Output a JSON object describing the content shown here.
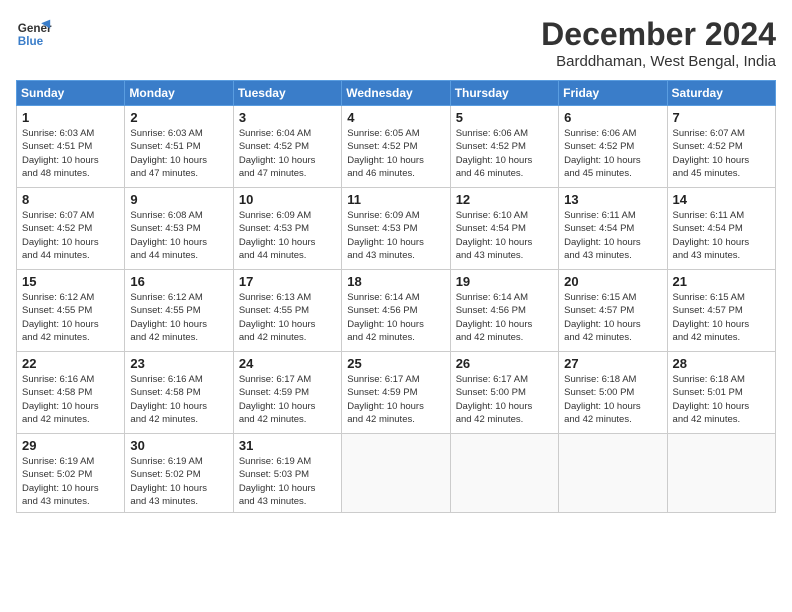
{
  "header": {
    "logo_line1": "General",
    "logo_line2": "Blue",
    "month": "December 2024",
    "location": "Barddhaman, West Bengal, India"
  },
  "weekdays": [
    "Sunday",
    "Monday",
    "Tuesday",
    "Wednesday",
    "Thursday",
    "Friday",
    "Saturday"
  ],
  "weeks": [
    [
      {
        "day": 1,
        "info": "Sunrise: 6:03 AM\nSunset: 4:51 PM\nDaylight: 10 hours\nand 48 minutes."
      },
      {
        "day": 2,
        "info": "Sunrise: 6:03 AM\nSunset: 4:51 PM\nDaylight: 10 hours\nand 47 minutes."
      },
      {
        "day": 3,
        "info": "Sunrise: 6:04 AM\nSunset: 4:52 PM\nDaylight: 10 hours\nand 47 minutes."
      },
      {
        "day": 4,
        "info": "Sunrise: 6:05 AM\nSunset: 4:52 PM\nDaylight: 10 hours\nand 46 minutes."
      },
      {
        "day": 5,
        "info": "Sunrise: 6:06 AM\nSunset: 4:52 PM\nDaylight: 10 hours\nand 46 minutes."
      },
      {
        "day": 6,
        "info": "Sunrise: 6:06 AM\nSunset: 4:52 PM\nDaylight: 10 hours\nand 45 minutes."
      },
      {
        "day": 7,
        "info": "Sunrise: 6:07 AM\nSunset: 4:52 PM\nDaylight: 10 hours\nand 45 minutes."
      }
    ],
    [
      {
        "day": 8,
        "info": "Sunrise: 6:07 AM\nSunset: 4:52 PM\nDaylight: 10 hours\nand 44 minutes."
      },
      {
        "day": 9,
        "info": "Sunrise: 6:08 AM\nSunset: 4:53 PM\nDaylight: 10 hours\nand 44 minutes."
      },
      {
        "day": 10,
        "info": "Sunrise: 6:09 AM\nSunset: 4:53 PM\nDaylight: 10 hours\nand 44 minutes."
      },
      {
        "day": 11,
        "info": "Sunrise: 6:09 AM\nSunset: 4:53 PM\nDaylight: 10 hours\nand 43 minutes."
      },
      {
        "day": 12,
        "info": "Sunrise: 6:10 AM\nSunset: 4:54 PM\nDaylight: 10 hours\nand 43 minutes."
      },
      {
        "day": 13,
        "info": "Sunrise: 6:11 AM\nSunset: 4:54 PM\nDaylight: 10 hours\nand 43 minutes."
      },
      {
        "day": 14,
        "info": "Sunrise: 6:11 AM\nSunset: 4:54 PM\nDaylight: 10 hours\nand 43 minutes."
      }
    ],
    [
      {
        "day": 15,
        "info": "Sunrise: 6:12 AM\nSunset: 4:55 PM\nDaylight: 10 hours\nand 42 minutes."
      },
      {
        "day": 16,
        "info": "Sunrise: 6:12 AM\nSunset: 4:55 PM\nDaylight: 10 hours\nand 42 minutes."
      },
      {
        "day": 17,
        "info": "Sunrise: 6:13 AM\nSunset: 4:55 PM\nDaylight: 10 hours\nand 42 minutes."
      },
      {
        "day": 18,
        "info": "Sunrise: 6:14 AM\nSunset: 4:56 PM\nDaylight: 10 hours\nand 42 minutes."
      },
      {
        "day": 19,
        "info": "Sunrise: 6:14 AM\nSunset: 4:56 PM\nDaylight: 10 hours\nand 42 minutes."
      },
      {
        "day": 20,
        "info": "Sunrise: 6:15 AM\nSunset: 4:57 PM\nDaylight: 10 hours\nand 42 minutes."
      },
      {
        "day": 21,
        "info": "Sunrise: 6:15 AM\nSunset: 4:57 PM\nDaylight: 10 hours\nand 42 minutes."
      }
    ],
    [
      {
        "day": 22,
        "info": "Sunrise: 6:16 AM\nSunset: 4:58 PM\nDaylight: 10 hours\nand 42 minutes."
      },
      {
        "day": 23,
        "info": "Sunrise: 6:16 AM\nSunset: 4:58 PM\nDaylight: 10 hours\nand 42 minutes."
      },
      {
        "day": 24,
        "info": "Sunrise: 6:17 AM\nSunset: 4:59 PM\nDaylight: 10 hours\nand 42 minutes."
      },
      {
        "day": 25,
        "info": "Sunrise: 6:17 AM\nSunset: 4:59 PM\nDaylight: 10 hours\nand 42 minutes."
      },
      {
        "day": 26,
        "info": "Sunrise: 6:17 AM\nSunset: 5:00 PM\nDaylight: 10 hours\nand 42 minutes."
      },
      {
        "day": 27,
        "info": "Sunrise: 6:18 AM\nSunset: 5:00 PM\nDaylight: 10 hours\nand 42 minutes."
      },
      {
        "day": 28,
        "info": "Sunrise: 6:18 AM\nSunset: 5:01 PM\nDaylight: 10 hours\nand 42 minutes."
      }
    ],
    [
      {
        "day": 29,
        "info": "Sunrise: 6:19 AM\nSunset: 5:02 PM\nDaylight: 10 hours\nand 43 minutes."
      },
      {
        "day": 30,
        "info": "Sunrise: 6:19 AM\nSunset: 5:02 PM\nDaylight: 10 hours\nand 43 minutes."
      },
      {
        "day": 31,
        "info": "Sunrise: 6:19 AM\nSunset: 5:03 PM\nDaylight: 10 hours\nand 43 minutes."
      },
      null,
      null,
      null,
      null
    ]
  ]
}
